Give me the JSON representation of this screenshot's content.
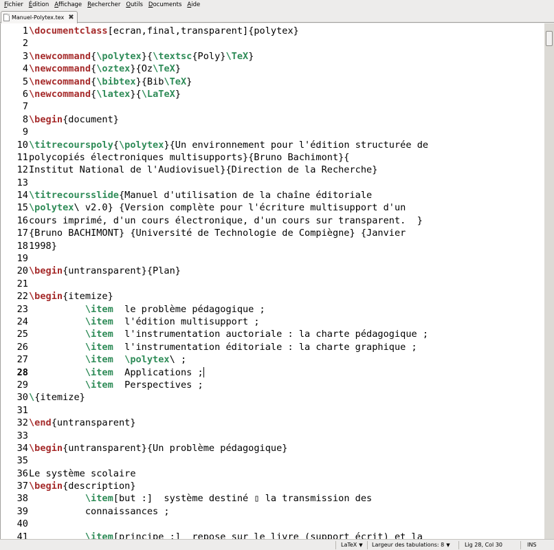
{
  "menubar": {
    "items": [
      {
        "acc": "F",
        "rest": "ichier"
      },
      {
        "acc": "É",
        "rest": "dition"
      },
      {
        "acc": "A",
        "rest": "ffichage"
      },
      {
        "acc": "R",
        "rest": "echercher"
      },
      {
        "acc": "O",
        "rest": "utils"
      },
      {
        "acc": "D",
        "rest": "ocuments"
      },
      {
        "acc": "A",
        "rest": "ide"
      }
    ]
  },
  "tab": {
    "label": "Manuel-Polytex.tex",
    "close": "✖"
  },
  "editor": {
    "current_line": "28",
    "lines": [
      {
        "n": "1",
        "tokens": [
          [
            "r",
            "\\documentclass"
          ],
          [
            "t",
            "[ecran,final,transparent]{polytex}"
          ]
        ]
      },
      {
        "n": "2",
        "tokens": []
      },
      {
        "n": "3",
        "tokens": [
          [
            "r",
            "\\newcommand"
          ],
          [
            "t",
            "{"
          ],
          [
            "g",
            "\\polytex"
          ],
          [
            "t",
            "}{"
          ],
          [
            "g",
            "\\textsc"
          ],
          [
            "t",
            "{Poly}"
          ],
          [
            "g",
            "\\TeX"
          ],
          [
            "t",
            "}"
          ]
        ]
      },
      {
        "n": "4",
        "tokens": [
          [
            "r",
            "\\newcommand"
          ],
          [
            "t",
            "{"
          ],
          [
            "g",
            "\\oztex"
          ],
          [
            "t",
            "}{Oz"
          ],
          [
            "g",
            "\\TeX"
          ],
          [
            "t",
            "}"
          ]
        ]
      },
      {
        "n": "5",
        "tokens": [
          [
            "r",
            "\\newcommand"
          ],
          [
            "t",
            "{"
          ],
          [
            "g",
            "\\bibtex"
          ],
          [
            "t",
            "}{Bib"
          ],
          [
            "g",
            "\\TeX"
          ],
          [
            "t",
            "}"
          ]
        ]
      },
      {
        "n": "6",
        "tokens": [
          [
            "r",
            "\\newcommand"
          ],
          [
            "t",
            "{"
          ],
          [
            "g",
            "\\latex"
          ],
          [
            "t",
            "}{"
          ],
          [
            "g",
            "\\LaTeX"
          ],
          [
            "t",
            "}"
          ]
        ]
      },
      {
        "n": "7",
        "tokens": []
      },
      {
        "n": "8",
        "tokens": [
          [
            "r",
            "\\begin"
          ],
          [
            "t",
            "{document}"
          ]
        ]
      },
      {
        "n": "9",
        "tokens": []
      },
      {
        "n": "10",
        "tokens": [
          [
            "g",
            "\\titrecourspoly"
          ],
          [
            "t",
            "{"
          ],
          [
            "g",
            "\\polytex"
          ],
          [
            "t",
            "}{Un environnement pour l'édition structurée de"
          ]
        ]
      },
      {
        "n": "11",
        "tokens": [
          [
            "t",
            "polycopiés électroniques multisupports}{Bruno Bachimont}{"
          ]
        ]
      },
      {
        "n": "12",
        "tokens": [
          [
            "t",
            "Institut National de l'Audiovisuel}{Direction de la Recherche}"
          ]
        ]
      },
      {
        "n": "13",
        "tokens": []
      },
      {
        "n": "14",
        "tokens": [
          [
            "g",
            "\\titrecoursslide"
          ],
          [
            "t",
            "{Manuel d'utilisation de la chaîne éditoriale"
          ]
        ]
      },
      {
        "n": "15",
        "tokens": [
          [
            "g",
            "\\polytex"
          ],
          [
            "t",
            "\\ v2.0} {Version complète pour l'écriture multisupport d'un"
          ]
        ]
      },
      {
        "n": "16",
        "tokens": [
          [
            "t",
            "cours imprimé, d'un cours électronique, d'un cours sur transparent.  }"
          ]
        ]
      },
      {
        "n": "17",
        "tokens": [
          [
            "t",
            "{Bruno BACHIMONT} {Université de Technologie de Compiègne} {Janvier"
          ]
        ]
      },
      {
        "n": "18",
        "tokens": [
          [
            "t",
            "1998}"
          ]
        ]
      },
      {
        "n": "19",
        "tokens": []
      },
      {
        "n": "20",
        "tokens": [
          [
            "r",
            "\\begin"
          ],
          [
            "t",
            "{untransparent}{Plan}"
          ]
        ]
      },
      {
        "n": "21",
        "tokens": []
      },
      {
        "n": "22",
        "tokens": [
          [
            "r",
            "\\begin"
          ],
          [
            "t",
            "{itemize}"
          ]
        ]
      },
      {
        "n": "23",
        "tokens": [
          [
            "t",
            "          "
          ],
          [
            "g",
            "\\item"
          ],
          [
            "t",
            "  le problème pédagogique ;"
          ]
        ]
      },
      {
        "n": "24",
        "tokens": [
          [
            "t",
            "          "
          ],
          [
            "g",
            "\\item"
          ],
          [
            "t",
            "  l'édition multisupport ;"
          ]
        ]
      },
      {
        "n": "25",
        "tokens": [
          [
            "t",
            "          "
          ],
          [
            "g",
            "\\item"
          ],
          [
            "t",
            "  l'instrumentation auctoriale : la charte pédagogique ;"
          ]
        ]
      },
      {
        "n": "26",
        "tokens": [
          [
            "t",
            "          "
          ],
          [
            "g",
            "\\item"
          ],
          [
            "t",
            "  l'instrumentation éditoriale : la charte graphique ;"
          ]
        ]
      },
      {
        "n": "27",
        "tokens": [
          [
            "t",
            "          "
          ],
          [
            "g",
            "\\item"
          ],
          [
            "t",
            "  "
          ],
          [
            "g",
            "\\polytex"
          ],
          [
            "t",
            "\\ ;"
          ]
        ]
      },
      {
        "n": "28",
        "tokens": [
          [
            "t",
            "          "
          ],
          [
            "g",
            "\\item"
          ],
          [
            "t",
            "  Applications ;"
          ],
          [
            "c",
            ""
          ]
        ]
      },
      {
        "n": "29",
        "tokens": [
          [
            "t",
            "          "
          ],
          [
            "g",
            "\\item"
          ],
          [
            "t",
            "  Perspectives ;"
          ]
        ]
      },
      {
        "n": "30",
        "tokens": [
          [
            "g",
            "\\"
          ],
          [
            "t",
            "{itemize}"
          ]
        ]
      },
      {
        "n": "31",
        "tokens": []
      },
      {
        "n": "32",
        "tokens": [
          [
            "r",
            "\\end"
          ],
          [
            "t",
            "{untransparent}"
          ]
        ]
      },
      {
        "n": "33",
        "tokens": []
      },
      {
        "n": "34",
        "tokens": [
          [
            "r",
            "\\begin"
          ],
          [
            "t",
            "{untransparent}{Un problème pédagogique}"
          ]
        ]
      },
      {
        "n": "35",
        "tokens": []
      },
      {
        "n": "36",
        "tokens": [
          [
            "t",
            "Le système scolaire"
          ]
        ]
      },
      {
        "n": "37",
        "tokens": [
          [
            "r",
            "\\begin"
          ],
          [
            "t",
            "{description}"
          ]
        ]
      },
      {
        "n": "38",
        "tokens": [
          [
            "t",
            "          "
          ],
          [
            "g",
            "\\item"
          ],
          [
            "t",
            "[but :]  système destiné ▯ la transmission des"
          ]
        ]
      },
      {
        "n": "39",
        "tokens": [
          [
            "t",
            "          connaissances ;"
          ]
        ]
      },
      {
        "n": "40",
        "tokens": []
      },
      {
        "n": "41",
        "tokens": [
          [
            "t",
            "          "
          ],
          [
            "g",
            "\\item"
          ],
          [
            "t",
            "[principe :]  repose sur le livre (support écrit) et la"
          ]
        ]
      }
    ]
  },
  "statusbar": {
    "language": "LaTeX",
    "tab_width": "Largeur des tabulations:  8",
    "position": "Lig 28, Col 30",
    "mode": "INS"
  },
  "colors": {
    "command_red": "#a52a2a",
    "command_green": "#2e8b57",
    "window_bg": "#edeceb"
  }
}
